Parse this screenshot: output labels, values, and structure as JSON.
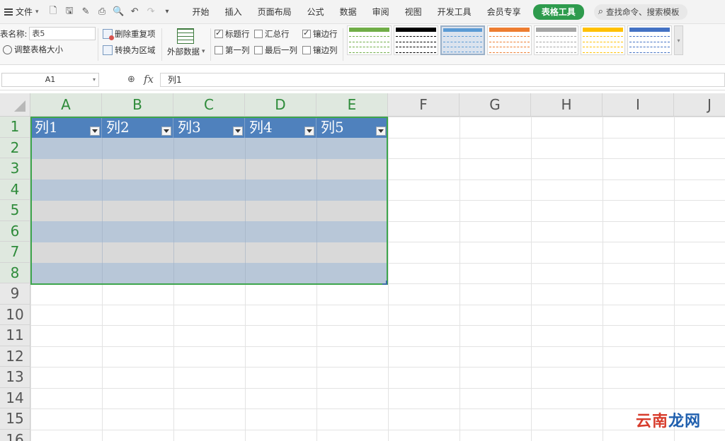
{
  "menubar": {
    "file_label": "文件",
    "tabs": [
      {
        "label": "开始"
      },
      {
        "label": "插入"
      },
      {
        "label": "页面布局"
      },
      {
        "label": "公式"
      },
      {
        "label": "数据"
      },
      {
        "label": "审阅"
      },
      {
        "label": "视图"
      },
      {
        "label": "开发工具"
      },
      {
        "label": "会员专享"
      },
      {
        "label": "表格工具",
        "active": true
      }
    ],
    "search_label": "查找命令、搜索模板"
  },
  "ribbon": {
    "table_name_label": "表名称:",
    "table_name_value": "表5",
    "resize_label": "调整表格大小",
    "remove_duplicates_label": "删除重复项",
    "convert_label": "转换为区域",
    "external_data_label": "外部数据",
    "options": {
      "header_row": {
        "label": "标题行",
        "checked": true
      },
      "total_row": {
        "label": "汇总行",
        "checked": false
      },
      "banded_rows": {
        "label": "镶边行",
        "checked": true
      },
      "first_column": {
        "label": "第一列",
        "checked": false
      },
      "last_column": {
        "label": "最后一列",
        "checked": false
      },
      "banded_columns": {
        "label": "镶边列",
        "checked": false
      }
    },
    "styles": [
      {
        "name": "green-outline",
        "color": "#70ad47"
      },
      {
        "name": "black",
        "color": "#000000"
      },
      {
        "name": "blue-gray",
        "color": "#5b9bd5",
        "selected": true
      },
      {
        "name": "orange",
        "color": "#ed7d31"
      },
      {
        "name": "gray",
        "color": "#a5a5a5"
      },
      {
        "name": "gold",
        "color": "#ffc000"
      },
      {
        "name": "blue",
        "color": "#4472c4"
      }
    ]
  },
  "formula_bar": {
    "cell_ref": "A1",
    "fx": "fx",
    "content": "列1"
  },
  "sheet": {
    "columns": [
      "A",
      "B",
      "C",
      "D",
      "E",
      "F",
      "G",
      "H",
      "I",
      "J"
    ],
    "rows": [
      "1",
      "2",
      "3",
      "4",
      "5",
      "6",
      "7",
      "8",
      "9",
      "10",
      "11",
      "12",
      "13",
      "14",
      "15",
      "16"
    ],
    "table_headers": [
      "列1",
      "列2",
      "列3",
      "列4",
      "列5"
    ],
    "header_color": "#4f81bd",
    "band_dark_color": "#b8c7d8",
    "band_light_color": "#d9d9d9",
    "selection_color": "#3da54c"
  },
  "watermark": {
    "part1": "云南",
    "part2": "龙网"
  }
}
